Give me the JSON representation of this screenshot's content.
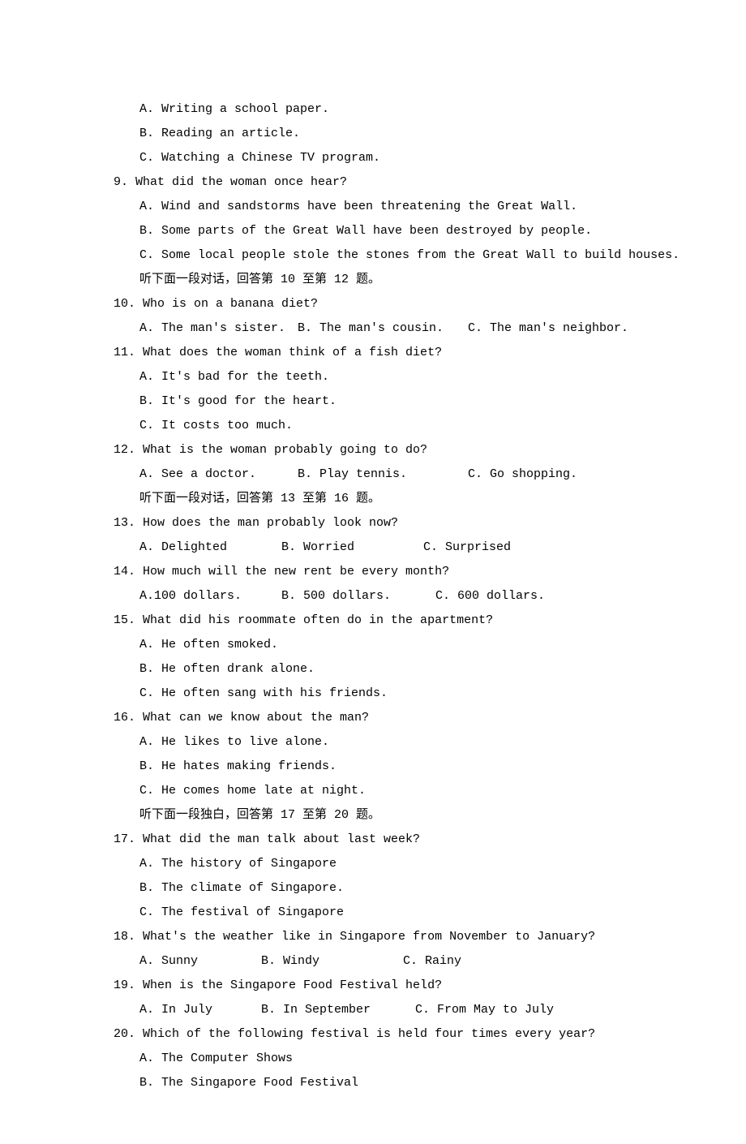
{
  "lines": {
    "pre_a": "A. Writing a school paper.",
    "pre_b": "B. Reading an article.",
    "pre_c": "C. Watching a Chinese TV program.",
    "q9": "9. What did the woman once hear?",
    "q9_a": "A. Wind and sandstorms have been threatening the Great Wall.",
    "q9_b": "B. Some parts of the Great Wall have been destroyed by people.",
    "q9_c": "C. Some local people stole the stones from the Great Wall to build houses.",
    "instr10": "听下面一段对话，回答第 10 至第 12 题。",
    "q10": "10. Who is on a banana diet?",
    "q10_a": "A. The man's sister.",
    "q10_b": "B. The man's cousin.",
    "q10_c": "C. The man's neighbor.",
    "q11": "11. What does the woman think of a fish diet?",
    "q11_a": "A. It's bad for the teeth.",
    "q11_b": "B. It's good for the heart.",
    "q11_c": "C. It costs too much.",
    "q12": "12. What is the woman probably going to do?",
    "q12_a": "A. See a doctor.",
    "q12_b": "B. Play tennis.",
    "q12_c": "C. Go shopping.",
    "instr13": "听下面一段对话，回答第 13 至第 16 题。",
    "q13": "13. How does the man probably look now?",
    "q13_a": "A. Delighted",
    "q13_b": "B. Worried",
    "q13_c": "C. Surprised",
    "q14": "14. How much will the new rent be every month?",
    "q14_a": "A.100 dollars.",
    "q14_b": "B. 500 dollars.",
    "q14_c": "C. 600 dollars.",
    "q15": "15. What did his roommate often do in the apartment?",
    "q15_a": "A. He often smoked.",
    "q15_b": "B. He often drank alone.",
    "q15_c": "C. He often sang with his friends.",
    "q16": "16. What can we know about the man?",
    "q16_a": "A. He likes to live alone.",
    "q16_b": "B. He hates making friends.",
    "q16_c": "C. He comes home late at night.",
    "instr17": "听下面一段独白，回答第 17 至第 20 题。",
    "q17": "17. What did the man talk about last week?",
    "q17_a": "A. The history of Singapore",
    "q17_b": "B. The climate of Singapore.",
    "q17_c": "C. The festival of Singapore",
    "q18": "18. What's the weather like in Singapore from November to January?",
    "q18_a": "A. Sunny",
    "q18_b": "B. Windy",
    "q18_c": "C. Rainy",
    "q19": "19. When is the Singapore Food Festival held?",
    "q19_a": "A. In July",
    "q19_b": "B. In September",
    "q19_c": "C. From May to July",
    "q20": "20. Which of the following festival is held four times every year?",
    "q20_a": "A. The Computer Shows",
    "q20_b": "B. The Singapore Food Festival"
  }
}
